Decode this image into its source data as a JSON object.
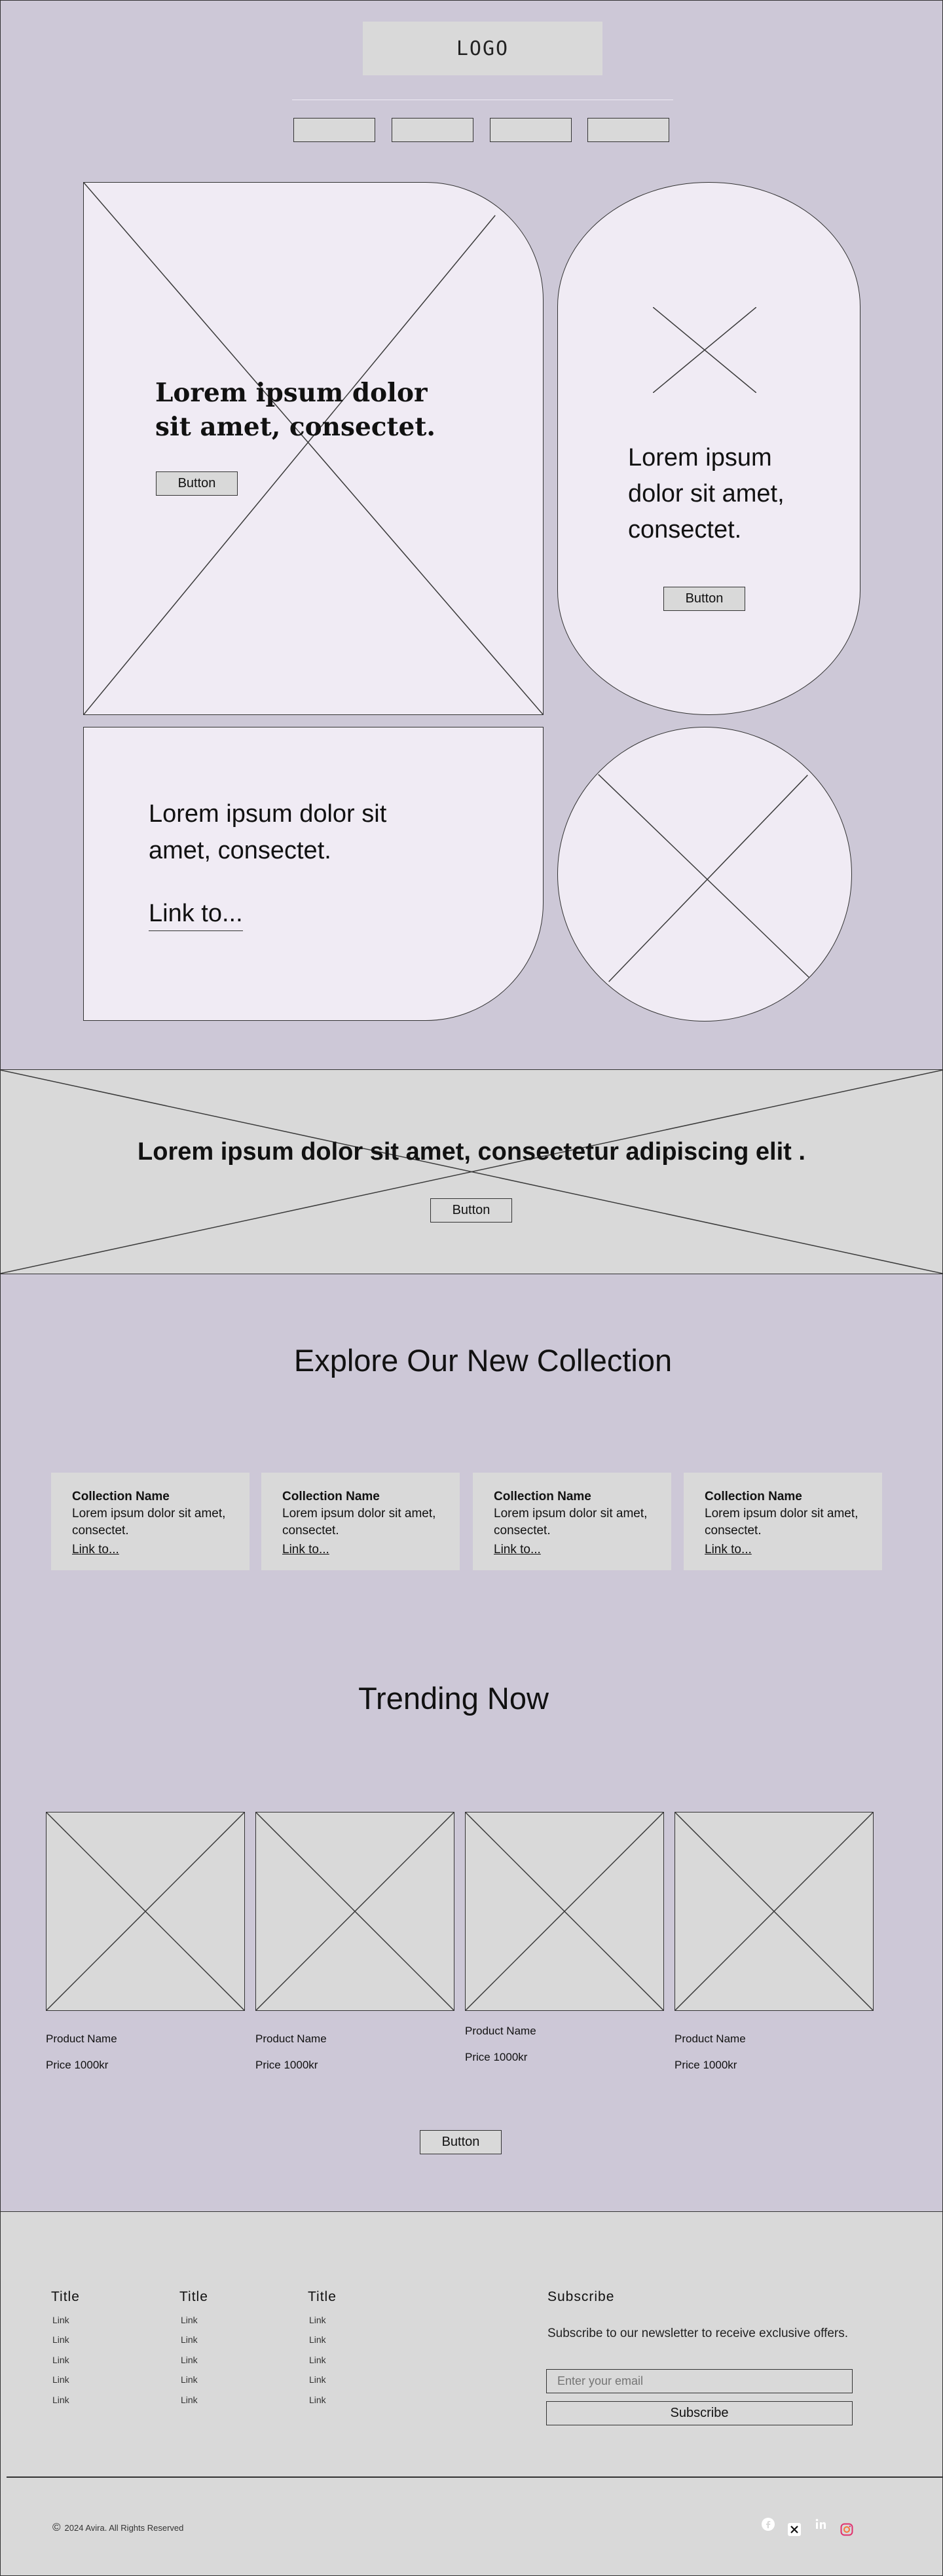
{
  "header": {
    "logo": "LOGO",
    "nav_count": 4
  },
  "hero": {
    "main_heading": "Lorem ipsum dolor sit amet, consectet.",
    "main_button": "Button",
    "side_text": "Lorem ipsum dolor sit amet, consectet.",
    "side_button": "Button",
    "bottom_text": "Lorem ipsum dolor sit amet, consectet.",
    "bottom_link": "Link to..."
  },
  "banner": {
    "text": "Lorem ipsum dolor sit amet, consectetur adipiscing elit .",
    "button": "Button"
  },
  "collection": {
    "title": "Explore Our New Collection",
    "cards": [
      {
        "name": "Collection Name",
        "desc": "Lorem ipsum dolor sit amet, consectet.",
        "link": "Link to..."
      },
      {
        "name": "Collection Name",
        "desc": "Lorem ipsum dolor sit amet, consectet.",
        "link": "Link to..."
      },
      {
        "name": "Collection Name",
        "desc": "Lorem ipsum dolor sit amet, consectet.",
        "link": "Link to..."
      },
      {
        "name": "Collection Name",
        "desc": "Lorem ipsum dolor sit amet, consectet.",
        "link": "Link to..."
      }
    ]
  },
  "trending": {
    "title": "Trending Now",
    "products": [
      {
        "name": "Product Name",
        "price": "Price 1000kr"
      },
      {
        "name": "Product Name",
        "price": "Price 1000kr"
      },
      {
        "name": "Product Name",
        "price": "Price 1000kr"
      },
      {
        "name": "Product Name",
        "price": "Price 1000kr"
      }
    ],
    "button": "Button"
  },
  "footer": {
    "columns": [
      {
        "title": "Title",
        "links": [
          "Link",
          "Link",
          "Link",
          "Link",
          "Link"
        ]
      },
      {
        "title": "Title",
        "links": [
          "Link",
          "Link",
          "Link",
          "Link",
          "Link"
        ]
      },
      {
        "title": "Title",
        "links": [
          "Link",
          "Link",
          "Link",
          "Link",
          "Link"
        ]
      }
    ],
    "subscribe": {
      "title": "Subscribe",
      "text": "Subscribe to our newsletter to receive exclusive offers.",
      "placeholder": "Enter your email",
      "button": "Subscribe"
    },
    "copyright": "2024 Avira. All Rights Reserved",
    "copyright_symbol": "©",
    "social_icons": [
      "facebook-icon",
      "x-icon",
      "linkedin-icon",
      "instagram-icon"
    ]
  },
  "colors": {
    "page_bg": "#cdc8d7",
    "panel_bg": "#f0ebf4",
    "block_bg": "#d9d9d9"
  }
}
